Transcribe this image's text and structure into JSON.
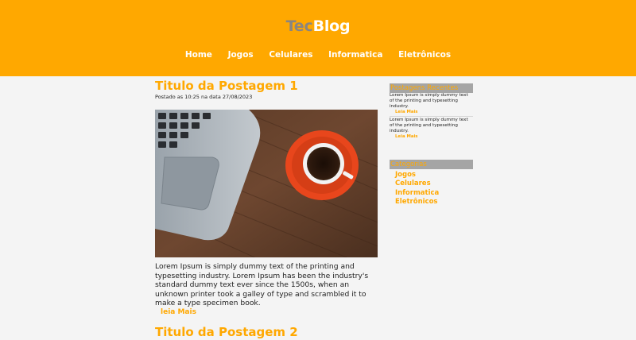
{
  "header": {
    "logo_part1": "Tec",
    "logo_part2": "Blog",
    "nav": [
      "Home",
      "Jogos",
      "Celulares",
      "Informatica",
      "Eletrônicos"
    ]
  },
  "posts": [
    {
      "title": "Titulo da Postagem 1",
      "meta": "Postado as 10:25 na data 27/08/2023",
      "body": "Lorem Ipsum is simply dummy text of the printing and typesetting industry. Lorem Ipsum has been the industry's standard dummy text ever since the 1500s, when an unknown printer took a galley of type and scrambled it to make a type specimen book.",
      "read_more": "leia Mais"
    },
    {
      "title": "Titulo da Postagem 2"
    }
  ],
  "sidebar": {
    "recent_title": "Postagens Recentes",
    "recent": [
      {
        "text": "Lorem Ipsum is simply dummy text of the printing and typesetting industry.",
        "read_more": "Leia Mais"
      },
      {
        "text": "Lorem Ipsum is simply dummy text of the printing and typesetting industry.",
        "read_more": "Leia Mais"
      }
    ],
    "categories_title": "Categorias",
    "categories": [
      "Jogos",
      "Celulares",
      "Informatica",
      "Eletrônicos"
    ]
  },
  "colors": {
    "accent": "#ffa800",
    "background": "#f4f4f4",
    "widget_header": "#a5a5a5"
  }
}
